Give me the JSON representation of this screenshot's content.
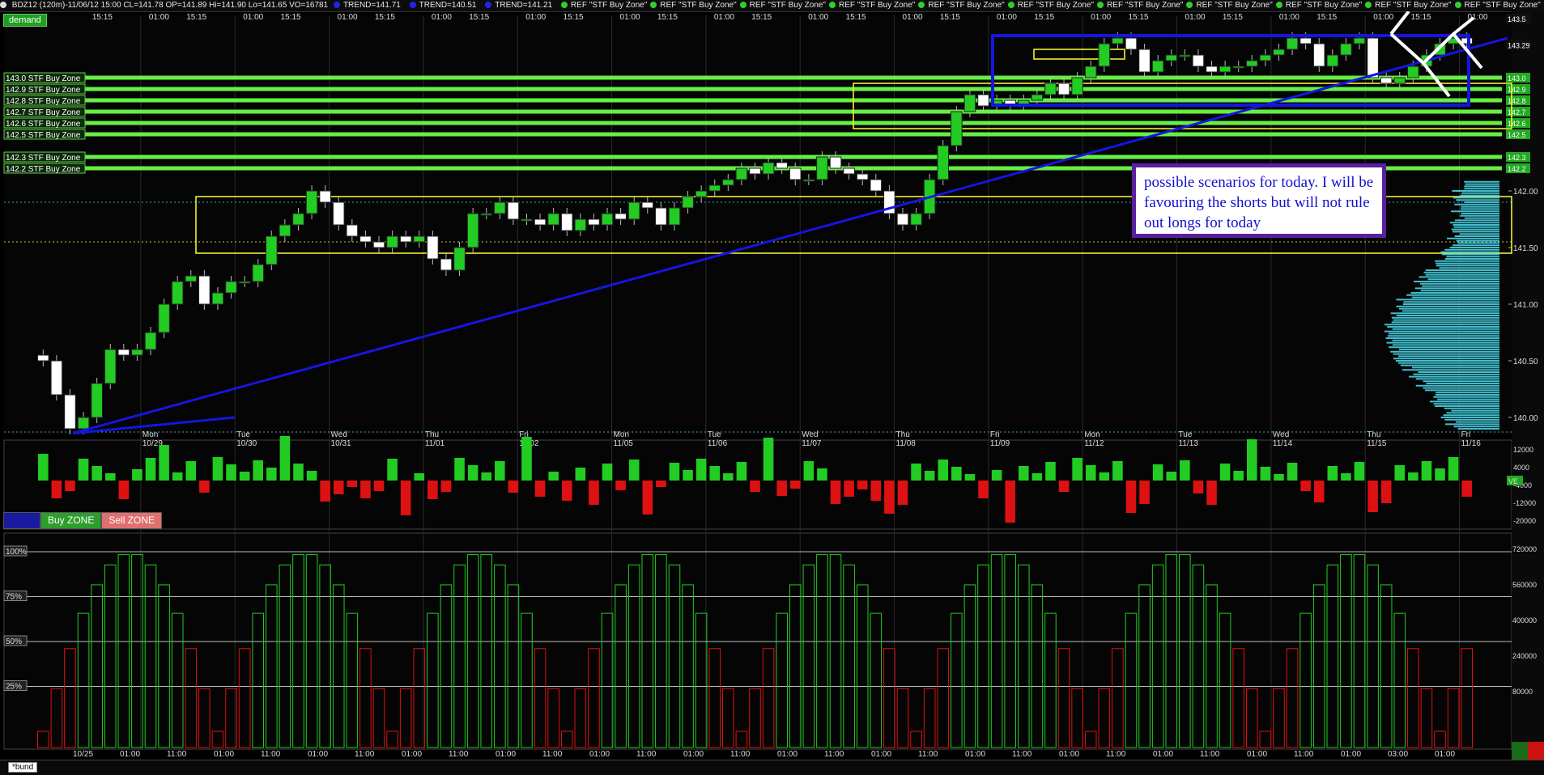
{
  "header": {
    "info": "BDZ12 (120m)-11/06/12 15:00 CL=141.78 OP=141.89 Hi=141.90 Lo=141.65 VO=16781",
    "trends": [
      "TREND=141.71",
      "TREND=140.51",
      "TREND=141.21"
    ],
    "ref_label": "REF \"STF Buy Zone\"",
    "ref_count": 14
  },
  "demand_label": "demand",
  "zone_buttons": {
    "buy": "Buy ZONE",
    "sell": "Sell ZONE"
  },
  "annotation": "possible scenarios for today.  I will be favouring the shorts but will not rule out longs for today",
  "tab_label": "*bund",
  "colors": {
    "up": "#22cc22",
    "down": "#ffffff",
    "zone_line": "#66ee44",
    "trend": "#1515e0",
    "box": "#ffff33",
    "profile": "#40c0d0",
    "vol_up": "#22cc22",
    "vol_down": "#dd1111"
  },
  "chart_data": {
    "type": "candlestick",
    "symbol": "BDZ12",
    "interval": "120m",
    "y_axis": {
      "ticks": [
        "140.00",
        "140.50",
        "141.00",
        "141.50",
        "142.00"
      ],
      "ylim": [
        139.85,
        143.55
      ]
    },
    "zone_lines": [
      {
        "label": "143.0 STF Buy Zone",
        "price": 143.0
      },
      {
        "label": "142.9 STF Buy Zone",
        "price": 142.9
      },
      {
        "label": "142.8 STF Buy Zone",
        "price": 142.8
      },
      {
        "label": "142.7 STF Buy Zone",
        "price": 142.7
      },
      {
        "label": "142.6 STF Buy Zone",
        "price": 142.6
      },
      {
        "label": "142.5 STF Buy Zone",
        "price": 142.5
      },
      {
        "label": "142.3 STF Buy Zone",
        "price": 142.3
      },
      {
        "label": "142.2 STF Buy Zone",
        "price": 142.2
      }
    ],
    "right_markers": [
      "143.29",
      "143.5",
      "143.0",
      "142.9",
      "142.8",
      "142.7",
      "142.6",
      "142.5",
      "142.3",
      "142.2"
    ],
    "date_labels": [
      {
        "day": "Mon",
        "date": "10/29"
      },
      {
        "day": "Tue",
        "date": "10/30"
      },
      {
        "day": "Wed",
        "date": "10/31"
      },
      {
        "day": "Thu",
        "date": "11/01"
      },
      {
        "day": "Fri",
        "date": "11/02"
      },
      {
        "day": "Mon",
        "date": "11/05"
      },
      {
        "day": "Tue",
        "date": "11/06"
      },
      {
        "day": "Wed",
        "date": "11/07"
      },
      {
        "day": "Thu",
        "date": "11/08"
      },
      {
        "day": "Fri",
        "date": "11/09"
      },
      {
        "day": "Mon",
        "date": "11/12"
      },
      {
        "day": "Tue",
        "date": "11/13"
      },
      {
        "day": "Wed",
        "date": "11/14"
      },
      {
        "day": "Thu",
        "date": "11/15"
      },
      {
        "day": "Fri",
        "date": "11/16"
      }
    ],
    "top_time_labels": [
      "15:15",
      "01:00"
    ],
    "bottom_time_labels": [
      "10/25",
      "01:00",
      "11:00",
      "01:00",
      "11:00",
      "01:00",
      "11:00",
      "01:00",
      "11:00",
      "01:00",
      "11:00",
      "01:00",
      "11:00",
      "01:00",
      "11:00",
      "01:00",
      "11:00",
      "01:00",
      "11:00",
      "01:00",
      "11:00",
      "01:00",
      "11:00",
      "01:00",
      "11:00",
      "01:00",
      "11:00",
      "01:00",
      "03:00",
      "01:00"
    ],
    "closes": [
      140.5,
      140.2,
      139.9,
      140.0,
      140.3,
      140.6,
      140.55,
      140.6,
      140.75,
      141.0,
      141.2,
      141.25,
      141.0,
      141.1,
      141.2,
      141.2,
      141.35,
      141.6,
      141.7,
      141.8,
      142.0,
      141.9,
      141.7,
      141.6,
      141.55,
      141.5,
      141.6,
      141.55,
      141.6,
      141.4,
      141.3,
      141.5,
      141.8,
      141.8,
      141.9,
      141.75,
      141.75,
      141.7,
      141.8,
      141.65,
      141.75,
      141.7,
      141.8,
      141.75,
      141.9,
      141.85,
      141.7,
      141.85,
      141.95,
      142.0,
      142.05,
      142.1,
      142.2,
      142.15,
      142.25,
      142.2,
      142.1,
      142.1,
      142.3,
      142.2,
      142.15,
      142.1,
      142.0,
      141.8,
      141.7,
      141.8,
      142.1,
      142.4,
      142.7,
      142.85,
      142.75,
      142.8,
      142.75,
      142.8,
      142.85,
      142.95,
      142.85,
      143.0,
      143.1,
      143.3,
      143.35,
      143.25,
      143.05,
      143.15,
      143.2,
      143.2,
      143.1,
      143.05,
      143.1,
      143.1,
      143.15,
      143.2,
      143.25,
      143.35,
      143.3,
      143.1,
      143.2,
      143.3,
      143.35,
      143.0,
      142.95,
      143.0,
      143.1,
      143.2,
      143.3,
      143.35,
      143.3
    ],
    "volume_ticks": [
      "12000",
      "4000",
      "-4000",
      "-12000",
      "-20000"
    ],
    "volume_label": "VE",
    "oscillator_ticks": [
      "720000",
      "560000",
      "400000",
      "240000",
      "80000"
    ],
    "oscillator_levels": [
      "100%",
      "75%",
      "50%",
      "25%"
    ]
  }
}
